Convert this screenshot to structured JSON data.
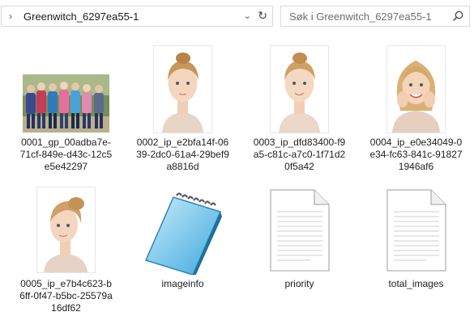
{
  "address_bar": {
    "path": "Greenwitch_6297ea55-1"
  },
  "search": {
    "placeholder": "Søk i Greenwitch_6297ea55-1"
  },
  "files": [
    {
      "label": "0001_gp_00adba7e-71cf-849e-d43c-12c5e5e42297",
      "kind": "group-photo"
    },
    {
      "label": "0002_ip_e2bfa14f-0639-2dc0-61a4-29bef9a8816d",
      "kind": "portrait"
    },
    {
      "label": "0003_ip_dfd83400-f9a5-c81c-a7c0-1f71d20f5a42",
      "kind": "portrait"
    },
    {
      "label": "0004_ip_e0e34049-0e34-fc63-841c-918271946af6",
      "kind": "portrait"
    },
    {
      "label": "0005_ip_e7b4c623-b6ff-0f47-b5bc-25579a16df62",
      "kind": "portrait"
    },
    {
      "label": "imageinfo",
      "kind": "notepad"
    },
    {
      "label": "priority",
      "kind": "text-file"
    },
    {
      "label": "total_images",
      "kind": "text-file"
    }
  ],
  "colors": {
    "border": "#d9d9d9",
    "text": "#1e1e1e",
    "placeholder": "#6d6d6d"
  }
}
